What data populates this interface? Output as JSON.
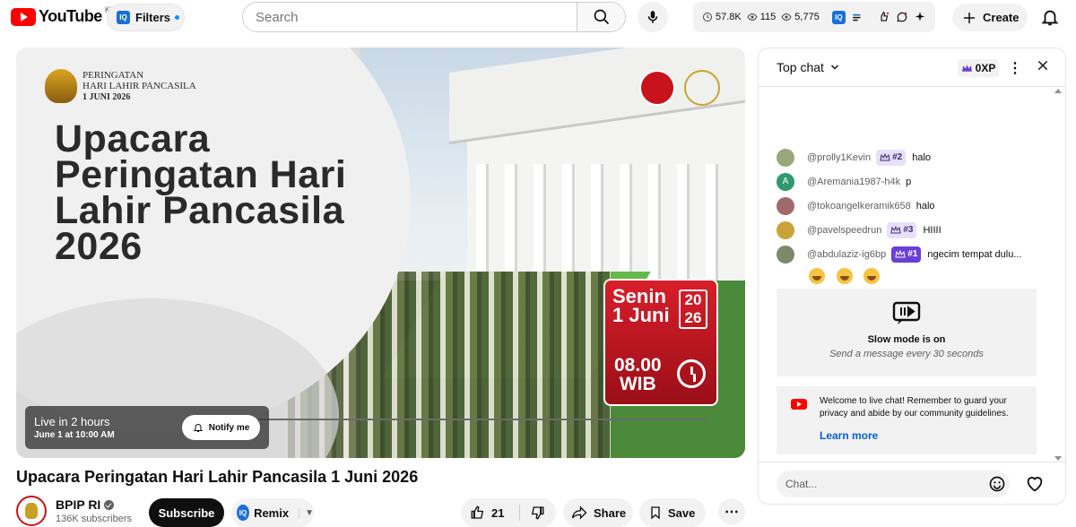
{
  "app": {
    "logo_text": "YouTube",
    "region": "KR"
  },
  "header": {
    "filters_label": "Filters",
    "search_placeholder": "Search",
    "stats": {
      "views_time": "57.8K",
      "viewers": "115",
      "watchers": "5,775"
    },
    "create_label": "Create"
  },
  "video": {
    "thumbnail": {
      "event_header": [
        "PERINGATAN",
        "HARI LAHIR PANCASILA",
        "1 JUNI 2026"
      ],
      "big_title": "Upacara Peringatan Hari Lahir Pancasila 2026",
      "day": "Senin",
      "date": "1 Juni",
      "year_top": "20",
      "year_bottom": "26",
      "time": "08.00",
      "zone": "WIB"
    },
    "live_status": "Live in 2 hours",
    "live_when": "June 1 at 10:00 AM",
    "notify_label": "Notify me",
    "title": "Upacara Peringatan Hari Lahir Pancasila 1 Juni 2026"
  },
  "channel": {
    "name": "BPIP RI",
    "subscribers": "136K subscribers",
    "subscribe_label": "Subscribe",
    "remix_label": "Remix"
  },
  "actions": {
    "likes": "21",
    "share_label": "Share",
    "save_label": "Save"
  },
  "chat": {
    "mode_label": "Top chat",
    "xp": "0XP",
    "messages": [
      {
        "author": "@prolly1Kevin",
        "badge": "#2",
        "text": "halo",
        "avatar_color": "#9aa77a"
      },
      {
        "author": "@Aremania1987-h4k",
        "badge": "",
        "text": "p",
        "avatar_color": "#2e9a6e",
        "initial": "A"
      },
      {
        "author": "@tokoangelkeramik658",
        "badge": "",
        "text": "halo",
        "avatar_color": "#a06a6a"
      },
      {
        "author": "@pavelspeedrun",
        "badge": "#3",
        "text": "HIIII",
        "avatar_color": "#c9a33a"
      },
      {
        "author": "@abdulaziz-ig6bp",
        "badge": "#1",
        "text": "ngecim tempat dulu...",
        "avatar_color": "#7d8a6a"
      }
    ],
    "slow_mode_title": "Slow mode is on",
    "slow_mode_sub": "Send a message every 30 seconds",
    "welcome_text": "Welcome to live chat! Remember to guard your privacy and abide by our community guidelines.",
    "learn_more": "Learn more",
    "input_placeholder": "Chat..."
  },
  "colors": {
    "brand_red": "#ff0000",
    "link_blue": "#065fd4",
    "badge_purple": "#6a3fd8"
  }
}
